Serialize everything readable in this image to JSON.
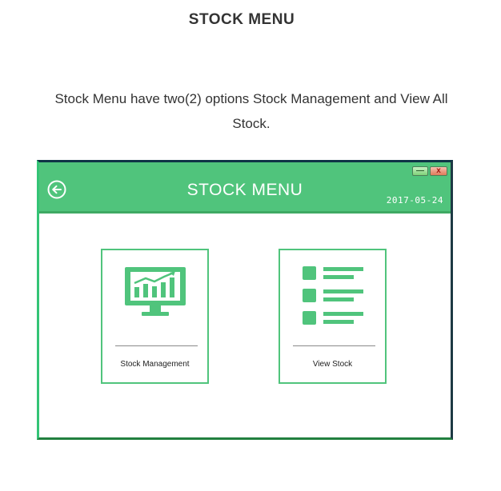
{
  "page": {
    "heading": "STOCK MENU",
    "description": "Stock Menu have two(2) options Stock Management and View All Stock."
  },
  "window": {
    "title": "STOCK MENU",
    "date": "2017-05-24",
    "controls": {
      "minimize_label": "—",
      "close_label": "x"
    },
    "back_icon": "back-arrow-icon"
  },
  "menu": {
    "items": [
      {
        "label": "Stock Management",
        "icon": "monitor-chart-icon"
      },
      {
        "label": "View Stock",
        "icon": "list-icon"
      }
    ]
  },
  "colors": {
    "accent": "#50c47c",
    "header_border": "#3fa963",
    "text": "#333333"
  }
}
